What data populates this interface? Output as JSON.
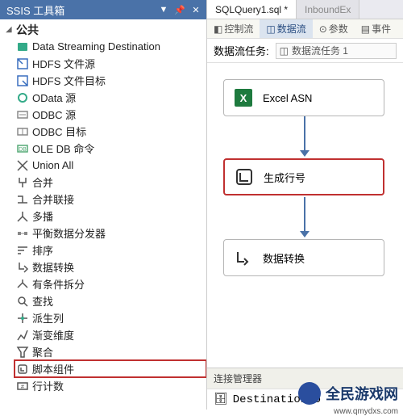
{
  "sidebar": {
    "title": "SSIS 工具箱",
    "root": "公共",
    "items": [
      {
        "label": "Data Streaming Destination"
      },
      {
        "label": "HDFS 文件源"
      },
      {
        "label": "HDFS 文件目标"
      },
      {
        "label": "OData 源"
      },
      {
        "label": "ODBC 源"
      },
      {
        "label": "ODBC 目标"
      },
      {
        "label": "OLE DB 命令"
      },
      {
        "label": "Union All"
      },
      {
        "label": "合并"
      },
      {
        "label": "合并联接"
      },
      {
        "label": "多播"
      },
      {
        "label": "平衡数据分发器"
      },
      {
        "label": "排序"
      },
      {
        "label": "数据转换"
      },
      {
        "label": "有条件拆分"
      },
      {
        "label": "查找"
      },
      {
        "label": "派生列"
      },
      {
        "label": "渐变维度"
      },
      {
        "label": "聚合"
      },
      {
        "label": "脚本组件",
        "highlight": true
      },
      {
        "label": "行计数"
      }
    ]
  },
  "tabs": {
    "file": "SQLQuery1.sql *",
    "file2": "InboundEx"
  },
  "subtabs": {
    "control": "控制流",
    "data": "数据流",
    "params": "参数",
    "events": "事件"
  },
  "taskbar": {
    "label": "数据流任务:",
    "value": "数据流任务 1"
  },
  "nodes": {
    "n1": "Excel ASN",
    "n2": "生成行号",
    "n3": "数据转换"
  },
  "footer": {
    "section": "连接管理器",
    "item": "DestinationCo"
  },
  "watermark": {
    "text": "全民游戏网",
    "url": "www.qmydxs.com"
  }
}
